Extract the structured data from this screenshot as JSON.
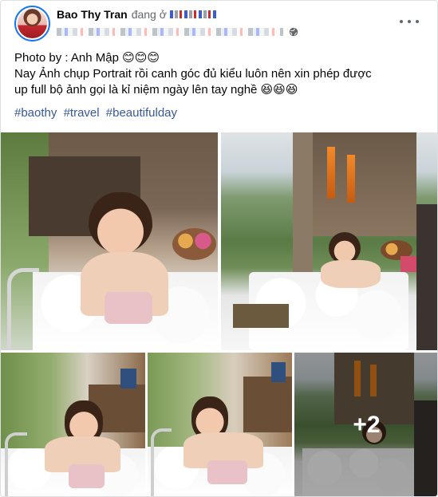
{
  "post": {
    "author": "Bao Thy Tran",
    "checkin_text": "đang ở",
    "caption_lines": [
      "Photo by : Anh Mập 😊😊😊",
      "Nay Ảnh chụp Portrait rồi canh góc đủ kiểu luôn nên  xin phép được",
      "up full bộ ảnh gọi là kỉ niệm ngày lên tay nghề 😆😆😆"
    ],
    "hashtags": [
      "#baothy",
      "#travel",
      "#beautifulday"
    ],
    "more_photos": "+2"
  },
  "icons": {
    "privacy": "globe-icon",
    "options": "more-horizontal-icon"
  },
  "colors": {
    "hashtag": "#385898",
    "avatar_ring": "#1877f2",
    "secondary_text": "#65676b"
  }
}
